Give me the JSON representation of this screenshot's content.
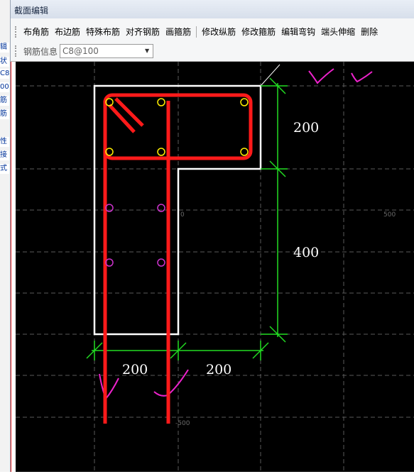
{
  "window": {
    "title": "截面编辑"
  },
  "toolbar": {
    "buttons": [
      "布角筋",
      "布边筋",
      "特殊布筋",
      "对齐钢筋",
      "画箍筋",
      "修改纵筋",
      "修改箍筋",
      "编辑弯钩",
      "端头伸缩",
      "删除"
    ],
    "rebar_info_label": "钢筋信息",
    "rebar_info_value": "C8@100"
  },
  "left_panel": {
    "fragments": [
      "辑",
      "状",
      "C8",
      "00",
      "筋",
      "筋",
      "性",
      "接",
      "式"
    ]
  },
  "drawing": {
    "dimensions": {
      "top_right": "200",
      "bottom_right": "400",
      "bottom_left": "200",
      "bottom_mid": "200"
    },
    "axis_labels": {
      "origin": "0",
      "x_right": "500",
      "y_bottom": "-500"
    }
  },
  "colors": {
    "concrete_outline": "#ffffff",
    "rebar": "#ff1a1a",
    "dimension": "#22dd22",
    "grid": "#5a5a5a",
    "canvas_bg": "#000000",
    "annotation": "#ee22cc",
    "stirrup_bar": "#ffee00",
    "side_bar": "#cc33cc"
  }
}
